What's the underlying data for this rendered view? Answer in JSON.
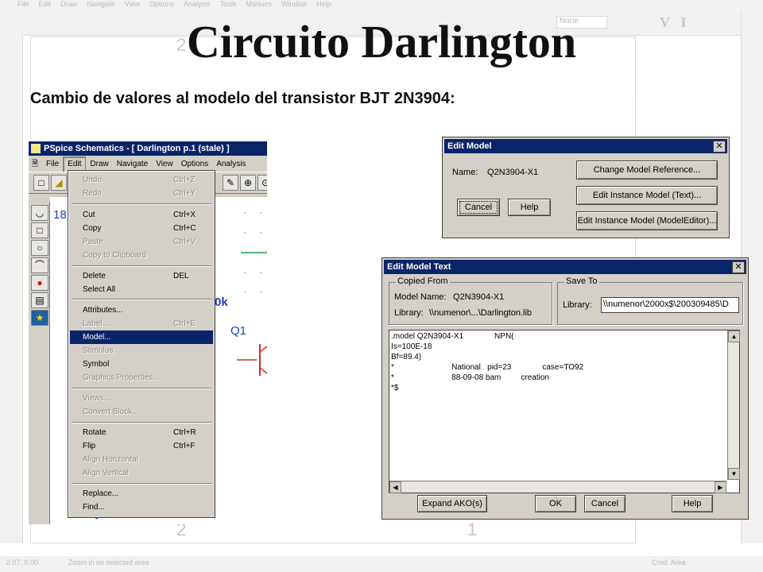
{
  "background_app": {
    "menu": [
      "File",
      "Edit",
      "Draw",
      "Navigate",
      "View",
      "Options",
      "Analysis",
      "Tools",
      "Markers",
      "Window",
      "Help"
    ],
    "none_select": "None",
    "canvas_numbers": [
      "2",
      "2",
      "1"
    ],
    "status_coords": "2.07, 0.00",
    "status_message": "Zoom in on selected area",
    "status_cmd": "Cmd: Area"
  },
  "slide": {
    "title": "Circuito Darlington",
    "subtitle": "Cambio de valores al modelo del transistor BJT 2N3904:"
  },
  "schematics": {
    "title": "PSpice Schematics - [ Darlington  p.1 (stale) ]",
    "menu": [
      "File",
      "Edit",
      "Draw",
      "Navigate",
      "View",
      "Options",
      "Analysis"
    ],
    "canvas_labels": {
      "top_num": "18",
      "res": "0k",
      "transistor": "Q1"
    }
  },
  "edit_menu": {
    "items": [
      {
        "label": "Undo",
        "shortcut": "Ctrl+Z",
        "disabled": true
      },
      {
        "label": "Redo",
        "shortcut": "Ctrl+Y",
        "disabled": true
      },
      {
        "label": "Cut",
        "shortcut": "Ctrl+X"
      },
      {
        "label": "Copy",
        "shortcut": "Ctrl+C"
      },
      {
        "label": "Paste",
        "shortcut": "Ctrl+V",
        "disabled": true
      },
      {
        "label": "Copy to Clipboard",
        "shortcut": "",
        "disabled": true
      },
      {
        "label": "Delete",
        "shortcut": "DEL"
      },
      {
        "label": "Select All",
        "shortcut": ""
      },
      {
        "label": "Attributes...",
        "shortcut": ""
      },
      {
        "label": "Label...",
        "shortcut": "Ctrl+E",
        "disabled": true
      },
      {
        "label": "Model...",
        "shortcut": "",
        "selected": true
      },
      {
        "label": "Stimulus",
        "shortcut": "",
        "disabled": true
      },
      {
        "label": "Symbol",
        "shortcut": ""
      },
      {
        "label": "Graphics Properties...",
        "shortcut": "",
        "disabled": true
      },
      {
        "label": "Views...",
        "shortcut": "",
        "disabled": true
      },
      {
        "label": "Convert Block...",
        "shortcut": "",
        "disabled": true
      },
      {
        "label": "Rotate",
        "shortcut": "Ctrl+R"
      },
      {
        "label": "Flip",
        "shortcut": "Ctrl+F"
      },
      {
        "label": "Align Horizontal",
        "shortcut": "",
        "disabled": true
      },
      {
        "label": "Align Vertical",
        "shortcut": "",
        "disabled": true
      },
      {
        "label": "Replace...",
        "shortcut": ""
      },
      {
        "label": "Find...",
        "shortcut": ""
      }
    ]
  },
  "edit_model_dialog": {
    "title": "Edit Model",
    "name_label": "Name:",
    "name_value": "Q2N3904-X1",
    "buttons": {
      "change_ref": "Change Model Reference...",
      "edit_text": "Edit Instance Model (Text)...",
      "edit_modeleditor": "Edit Instance Model (ModelEditor)...",
      "cancel": "Cancel",
      "help": "Help"
    }
  },
  "edit_model_text_dialog": {
    "title": "Edit Model Text",
    "copied_from": {
      "group_title": "Copied From",
      "model_name_label": "Model Name:",
      "model_name_value": "Q2N3904-X1",
      "library_label": "Library:",
      "library_value": "\\\\numenor\\...\\Darlington.lib"
    },
    "save_to": {
      "group_title": "Save To",
      "library_label": "Library:",
      "library_value": "\\\\numenor\\2000x$\\200309485\\D"
    },
    "text_lines": [
      ".model Q2N3904-X1              NPN(",
      "Is=100E-18",
      "Bf=89.4)",
      "*                          National   pid=23              case=TO92",
      "*                          88-09-08 bam         creation",
      "*$"
    ],
    "buttons": {
      "expand": "Expand AKO(s)",
      "ok": "OK",
      "cancel": "Cancel",
      "help": "Help"
    }
  }
}
